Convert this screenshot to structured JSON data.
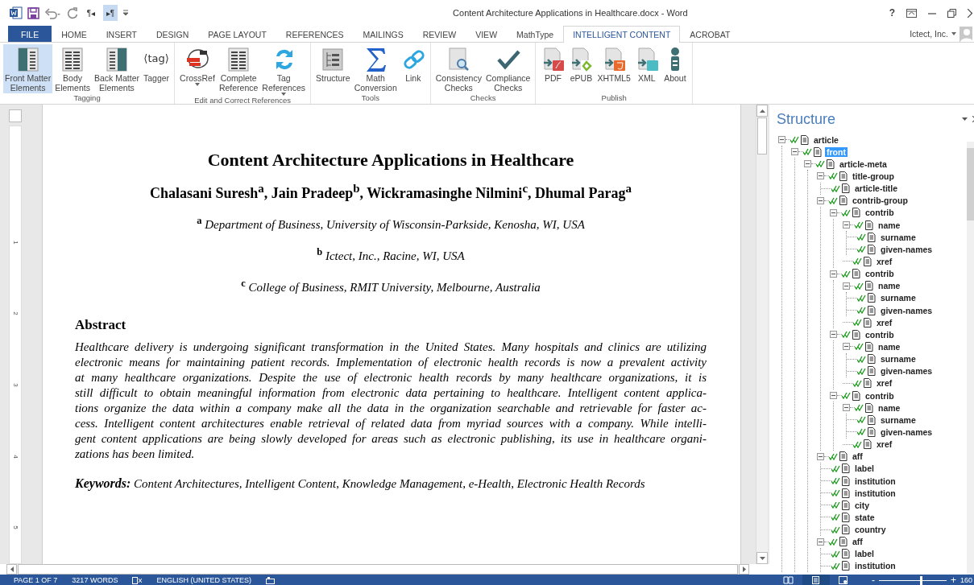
{
  "window": {
    "title": "Content Architecture Applications in Healthcare.docx - Word",
    "help": "?"
  },
  "quick_access": [
    {
      "kind": "logo"
    },
    {
      "kind": "save"
    },
    {
      "kind": "undo"
    },
    {
      "kind": "redo"
    },
    {
      "kind": "glyph",
      "text": "¶◂",
      "on": false
    },
    {
      "kind": "glyph",
      "text": "▸¶",
      "on": true
    },
    {
      "kind": "customize"
    }
  ],
  "tabs": [
    {
      "label": "FILE",
      "kind": "file",
      "selected": false
    },
    {
      "label": "HOME",
      "kind": "tab",
      "selected": false
    },
    {
      "label": "INSERT",
      "kind": "tab",
      "selected": false
    },
    {
      "label": "DESIGN",
      "kind": "tab",
      "selected": false
    },
    {
      "label": "PAGE LAYOUT",
      "kind": "tab",
      "selected": false
    },
    {
      "label": "REFERENCES",
      "kind": "tab",
      "selected": false
    },
    {
      "label": "MAILINGS",
      "kind": "tab",
      "selected": false
    },
    {
      "label": "REVIEW",
      "kind": "tab",
      "selected": false
    },
    {
      "label": "VIEW",
      "kind": "tab",
      "selected": false
    },
    {
      "label": "MathType",
      "kind": "tab",
      "selected": false
    },
    {
      "label": "INTELLIGENT CONTENT",
      "kind": "tab",
      "selected": true
    },
    {
      "label": "ACROBAT",
      "kind": "tab",
      "selected": false
    }
  ],
  "account": "Ictect, Inc.",
  "ribbon_groups": [
    {
      "label": "Tagging",
      "buttons": [
        {
          "label": "Front Matter\nElements",
          "selected": true
        },
        {
          "label": "Body\nElements",
          "selected": false
        },
        {
          "label": "Back Matter\nElements",
          "selected": false
        },
        {
          "label": "Tagger",
          "glyph": "⟨tag⟩",
          "selected": false
        }
      ]
    },
    {
      "label": "Edit and Correct References",
      "buttons": [
        {
          "label": "CrossRef",
          "dropdown": true,
          "selected": false
        },
        {
          "label": "Complete\nReference",
          "selected": false
        },
        {
          "label": "Tag\nReferences",
          "dropdown": true,
          "selected": false
        }
      ]
    },
    {
      "label": "Tools",
      "buttons": [
        {
          "label": "Structure",
          "selected": false
        },
        {
          "label": "Math\nConversion",
          "selected": false
        },
        {
          "label": "Link",
          "selected": false
        }
      ]
    },
    {
      "label": "Checks",
      "buttons": [
        {
          "label": "Consistency\nChecks",
          "selected": false
        },
        {
          "label": "Compliance\nChecks",
          "selected": false
        }
      ]
    },
    {
      "label": "Publish",
      "buttons": [
        {
          "label": "PDF",
          "selected": false
        },
        {
          "label": "ePUB",
          "selected": false
        },
        {
          "label": "XHTML5",
          "selected": false
        },
        {
          "label": "XML",
          "selected": false
        },
        {
          "label": "About",
          "selected": false
        }
      ]
    }
  ],
  "ruler_marks": [
    "1",
    "2",
    "3",
    "4",
    "5"
  ],
  "document": {
    "title": "Content Architecture Applications in Healthcare",
    "authors": "Chalasani Suresh$^{a}$, Jain Pradeep$^{b}$, Wickramasinghe Nilmini$^{c}$, Dhumal Parag$^{a}$",
    "affiliations": [
      "$^{a}$ Department of Business, University of Wisconsin-Parkside, Kenosha, WI, USA",
      "$^{b}$ Ictect, Inc., Racine, WI, USA",
      "$^{c}$ College of Business, RMIT University, Melbourne, Australia"
    ],
    "abstract_heading": "Abstract",
    "abstract_lines": [
      "Healthcare delivery is undergoing significant transformation in the United States. Many hospitals and clinics are utilizing",
      "electronic means for maintaining patient records. Implementation of electronic health records is now a prevalent activity",
      "at many healthcare organizations. Despite the use of electronic health records by many healthcare organizations, it is",
      "still difficult to obtain meaningful information from electronic data pertaining to healthcare. Intelligent content applica-",
      "tions organize the data within a company make all the data in the organization searchable and retrievable for faster ac-",
      "cess. Intelligent content architectures enable retrieval of related data from myriad sources with a company. While intelli-",
      "gent content applications are being slowly developed for areas such as electronic publishing, its use in healthcare organi-",
      "zations has been limited."
    ],
    "keywords": "**Keywords:** Content Architectures, Intelligent Content, Knowledge Management, e-Health, Electronic Health Records"
  },
  "structure_pane": {
    "title": "Structure",
    "tree": [
      {
        "label": "article",
        "selected": false,
        "expanded": true,
        "children": [
          {
            "label": "front",
            "selected": true,
            "expanded": true,
            "children": [
              {
                "label": "article-meta",
                "selected": false,
                "expanded": true,
                "children": [
                  {
                    "label": "title-group",
                    "selected": false,
                    "expanded": true,
                    "children": [
                      {
                        "label": "article-title",
                        "selected": false
                      }
                    ]
                  },
                  {
                    "label": "contrib-group",
                    "selected": false,
                    "expanded": true,
                    "children": [
                      {
                        "label": "contrib",
                        "selected": false,
                        "expanded": true,
                        "children": [
                          {
                            "label": "name",
                            "selected": false,
                            "expanded": true,
                            "children": [
                              {
                                "label": "surname",
                                "selected": false
                              },
                              {
                                "label": "given-names",
                                "selected": false
                              }
                            ]
                          },
                          {
                            "label": "xref",
                            "selected": false
                          }
                        ]
                      },
                      {
                        "label": "contrib",
                        "selected": false,
                        "expanded": true,
                        "children": [
                          {
                            "label": "name",
                            "selected": false,
                            "expanded": true,
                            "children": [
                              {
                                "label": "surname",
                                "selected": false
                              },
                              {
                                "label": "given-names",
                                "selected": false
                              }
                            ]
                          },
                          {
                            "label": "xref",
                            "selected": false
                          }
                        ]
                      },
                      {
                        "label": "contrib",
                        "selected": false,
                        "expanded": true,
                        "children": [
                          {
                            "label": "name",
                            "selected": false,
                            "expanded": true,
                            "children": [
                              {
                                "label": "surname",
                                "selected": false
                              },
                              {
                                "label": "given-names",
                                "selected": false
                              }
                            ]
                          },
                          {
                            "label": "xref",
                            "selected": false
                          }
                        ]
                      },
                      {
                        "label": "contrib",
                        "selected": false,
                        "expanded": true,
                        "children": [
                          {
                            "label": "name",
                            "selected": false,
                            "expanded": true,
                            "children": [
                              {
                                "label": "surname",
                                "selected": false
                              },
                              {
                                "label": "given-names",
                                "selected": false
                              }
                            ]
                          },
                          {
                            "label": "xref",
                            "selected": false
                          }
                        ]
                      }
                    ]
                  },
                  {
                    "label": "aff",
                    "selected": false,
                    "expanded": true,
                    "children": [
                      {
                        "label": "label",
                        "selected": false
                      },
                      {
                        "label": "institution",
                        "selected": false
                      },
                      {
                        "label": "institution",
                        "selected": false
                      },
                      {
                        "label": "city",
                        "selected": false
                      },
                      {
                        "label": "state",
                        "selected": false
                      },
                      {
                        "label": "country",
                        "selected": false
                      }
                    ]
                  },
                  {
                    "label": "aff",
                    "selected": false,
                    "expanded": true,
                    "children": [
                      {
                        "label": "label",
                        "selected": false
                      },
                      {
                        "label": "institution",
                        "selected": false
                      }
                    ]
                  }
                ]
              }
            ]
          }
        ]
      }
    ]
  },
  "status_bar": {
    "page": "PAGE 1 OF 7",
    "words": "3217 WORDS",
    "language": "ENGLISH (UNITED STATES)",
    "views": [
      {
        "kind": "read",
        "selected": false
      },
      {
        "kind": "print",
        "selected": true
      },
      {
        "kind": "web",
        "selected": false
      }
    ],
    "zoom_out": "-",
    "zoom_in": "+",
    "zoom": {
      "level": 0.62
    },
    "zoom_value": "160"
  }
}
